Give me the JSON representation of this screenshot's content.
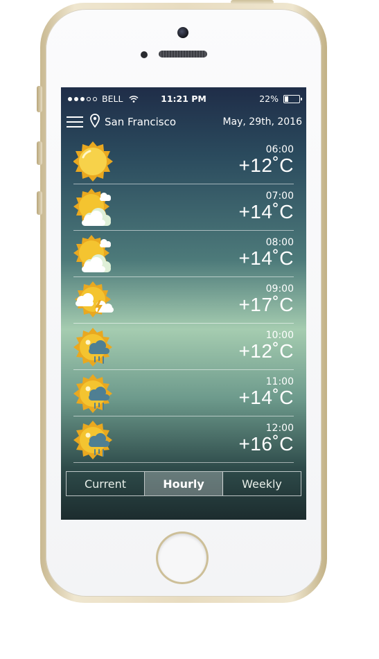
{
  "status_bar": {
    "carrier": "BELL",
    "time": "11:21 PM",
    "battery_percent": "22%",
    "battery_level": 0.22
  },
  "header": {
    "city": "San Francisco",
    "date": "May, 29th, 2016"
  },
  "hourly": [
    {
      "time": "06:00",
      "temp": "+12˚C",
      "icon": "sun-icon"
    },
    {
      "time": "07:00",
      "temp": "+14˚C",
      "icon": "sun-cloud-icon"
    },
    {
      "time": "08:00",
      "temp": "+14˚C",
      "icon": "sun-cloud-icon"
    },
    {
      "time": "09:00",
      "temp": "+17˚C",
      "icon": "sun-thunderstorm-icon"
    },
    {
      "time": "10:00",
      "temp": "+12˚C",
      "icon": "sun-rain-icon"
    },
    {
      "time": "11:00",
      "temp": "+14˚C",
      "icon": "sun-rain-icon"
    },
    {
      "time": "12:00",
      "temp": "+16˚C",
      "icon": "sun-rain-icon"
    }
  ],
  "tabs": [
    {
      "label": "Current",
      "active": false
    },
    {
      "label": "Hourly",
      "active": true
    },
    {
      "label": "Weekly",
      "active": false
    }
  ]
}
